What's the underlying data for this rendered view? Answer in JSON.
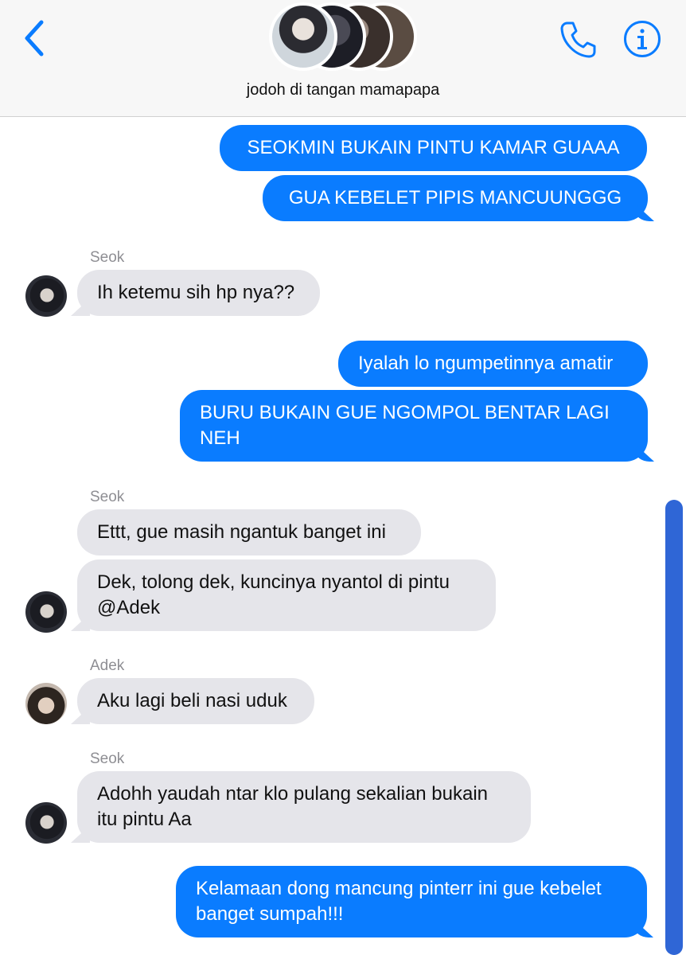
{
  "header": {
    "group_name": "jodoh di tangan mamapapa",
    "icons": {
      "back": "chevron-left-icon",
      "call": "phone-icon",
      "info": "info-icon"
    },
    "accent_color": "#0a7cff"
  },
  "messages": [
    {
      "side": "out",
      "text": "SEOKMIN BUKAIN PINTU KAMAR GUAAA"
    },
    {
      "side": "out",
      "text": "GUA KEBELET PIPIS MANCUUNGGG"
    },
    {
      "side": "in",
      "sender": "Seok",
      "text": "Ih ketemu sih hp nya??"
    },
    {
      "side": "out",
      "text": "Iyalah lo ngumpetinnya amatir"
    },
    {
      "side": "out",
      "lines": [
        "BURU BUKAIN GUE NGOMPOL BENTAR LAGI",
        "NEH"
      ]
    },
    {
      "side": "in",
      "sender": "Seok",
      "text": "Ettt, gue masih ngantuk banget ini"
    },
    {
      "side": "in",
      "lines": [
        "Dek, tolong dek, kuncinya nyantol di pintu",
        "@Adek"
      ]
    },
    {
      "side": "in",
      "sender": "Adek",
      "text": "Aku lagi beli nasi uduk"
    },
    {
      "side": "in",
      "sender": "Seok",
      "lines": [
        "Adohh yaudah ntar klo pulang sekalian bukain",
        "itu pintu Aa"
      ]
    },
    {
      "side": "out",
      "lines": [
        "Kelamaan dong mancung pinterr ini gue kebelet",
        "banget sumpah!!!"
      ]
    }
  ]
}
